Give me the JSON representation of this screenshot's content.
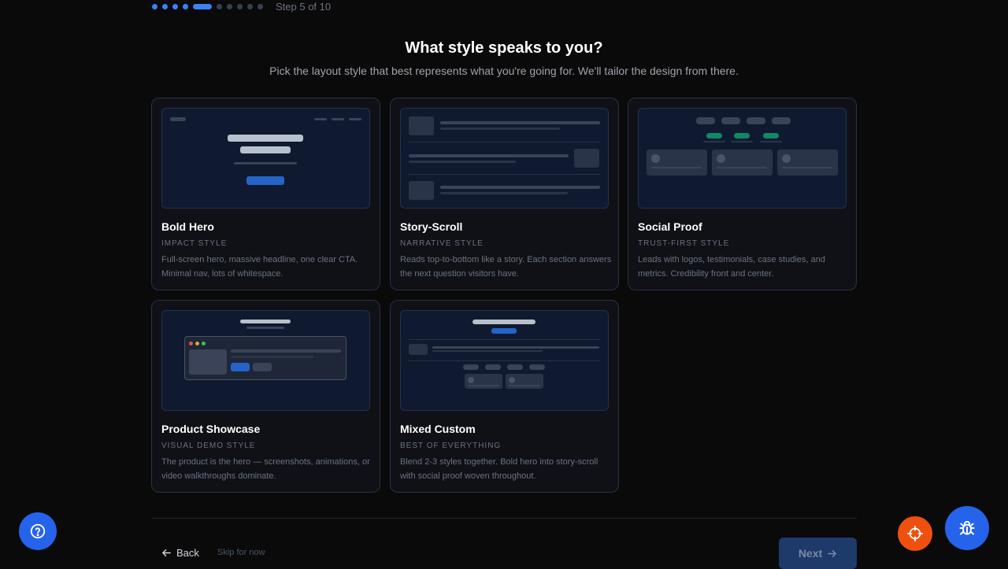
{
  "progress": {
    "total_steps": 10,
    "current_step": 5,
    "label": "Step 5 of 10"
  },
  "heading": "What style speaks to you?",
  "subheading": "Pick the layout style that best represents what you're going for. We'll tailor the design from there.",
  "cards": [
    {
      "title": "Bold Hero",
      "tag": "IMPACT STYLE",
      "description": "Full-screen hero, massive headline, one clear CTA. Minimal nav, lots of whitespace."
    },
    {
      "title": "Story-Scroll",
      "tag": "NARRATIVE STYLE",
      "description": "Reads top-to-bottom like a story. Each section answers the next question visitors have."
    },
    {
      "title": "Social Proof",
      "tag": "TRUST-FIRST STYLE",
      "description": "Leads with logos, testimonials, case studies, and metrics. Credibility front and center."
    },
    {
      "title": "Product Showcase",
      "tag": "VISUAL DEMO STYLE",
      "description": "The product is the hero — screenshots, animations, or video walkthroughs dominate."
    },
    {
      "title": "Mixed Custom",
      "tag": "BEST OF EVERYTHING",
      "description": "Blend 2-3 styles together. Bold hero into story-scroll with social proof woven throughout."
    }
  ],
  "footer": {
    "back_label": "Back",
    "skip_label": "Skip for now",
    "next_label": "Next"
  },
  "colors": {
    "accent": "#3b82f6",
    "background": "#0a0a0b",
    "target_button": "#f0500e"
  },
  "icons": {
    "help": "help-circle-icon",
    "target": "crosshair-icon",
    "bug": "bug-icon"
  }
}
